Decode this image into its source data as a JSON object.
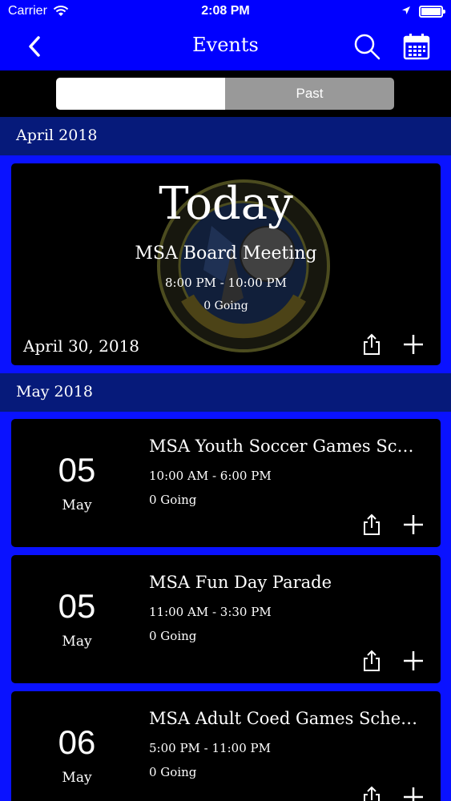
{
  "status_bar": {
    "carrier": "Carrier",
    "time": "2:08 PM"
  },
  "nav": {
    "title": "Events",
    "icons": [
      "back-chevron-icon",
      "search-icon",
      "calendar-icon"
    ]
  },
  "segments": {
    "upcoming": "",
    "past": "Past",
    "selected": "upcoming"
  },
  "sections": [
    {
      "header": "April 2018"
    },
    {
      "header": "May 2018"
    }
  ],
  "featured": {
    "badge": "Today",
    "title": "MSA Board Meeting",
    "time": "8:00 PM - 10:00 PM",
    "going": "0 Going",
    "date": "April 30, 2018"
  },
  "events": [
    {
      "day": "05",
      "month": "May",
      "title": "MSA Youth Soccer Games Schedule",
      "time": "10:00 AM - 6:00 PM",
      "going": "0 Going"
    },
    {
      "day": "05",
      "month": "May",
      "title": "MSA Fun Day Parade",
      "time": "11:00 AM - 3:30 PM",
      "going": "0 Going"
    },
    {
      "day": "06",
      "month": "May",
      "title": "MSA Adult Coed Games Schedule",
      "time": "5:00 PM - 11:00 PM",
      "going": "0 Going"
    }
  ],
  "colors": {
    "nav": "#0000ff",
    "background": "#0a12ff",
    "section": "#061a7a",
    "card": "#000000"
  }
}
